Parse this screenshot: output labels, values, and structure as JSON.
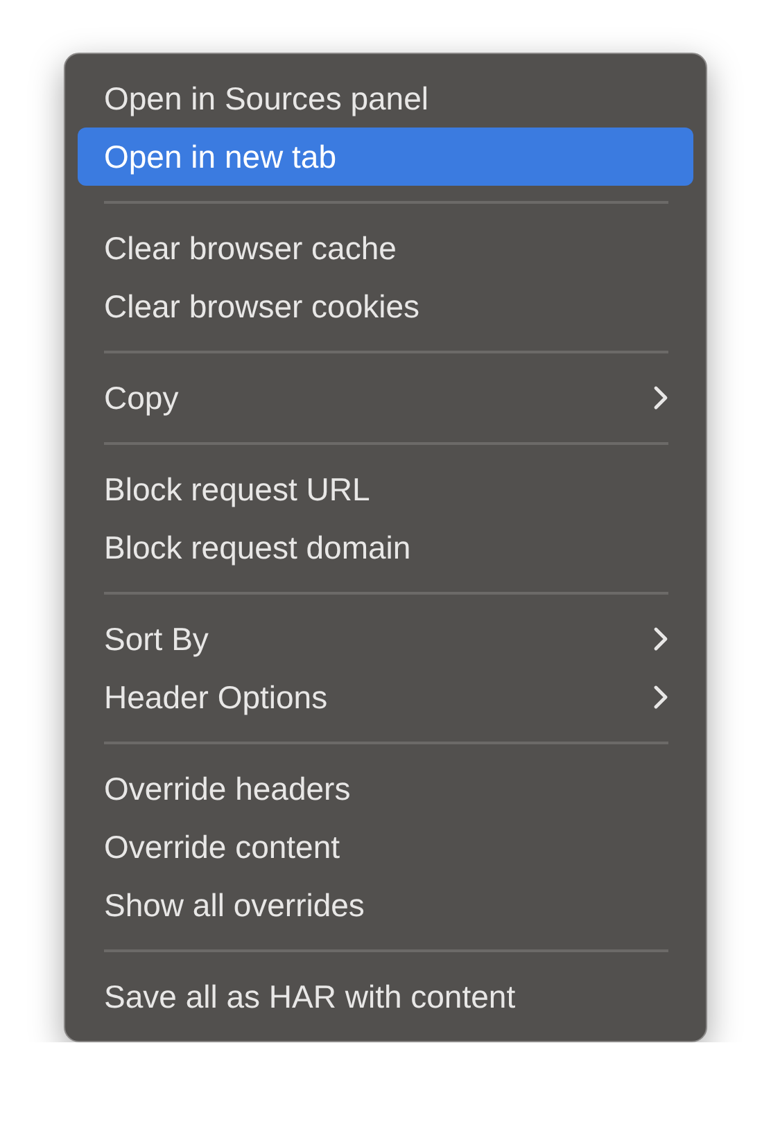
{
  "menu": {
    "groups": [
      {
        "items": [
          {
            "label": "Open in Sources panel",
            "selected": false,
            "submenu": false
          },
          {
            "label": "Open in new tab",
            "selected": true,
            "submenu": false
          }
        ]
      },
      {
        "items": [
          {
            "label": "Clear browser cache",
            "selected": false,
            "submenu": false
          },
          {
            "label": "Clear browser cookies",
            "selected": false,
            "submenu": false
          }
        ]
      },
      {
        "items": [
          {
            "label": "Copy",
            "selected": false,
            "submenu": true
          }
        ]
      },
      {
        "items": [
          {
            "label": "Block request URL",
            "selected": false,
            "submenu": false
          },
          {
            "label": "Block request domain",
            "selected": false,
            "submenu": false
          }
        ]
      },
      {
        "items": [
          {
            "label": "Sort By",
            "selected": false,
            "submenu": true
          },
          {
            "label": "Header Options",
            "selected": false,
            "submenu": true
          }
        ]
      },
      {
        "items": [
          {
            "label": "Override headers",
            "selected": false,
            "submenu": false
          },
          {
            "label": "Override content",
            "selected": false,
            "submenu": false
          },
          {
            "label": "Show all overrides",
            "selected": false,
            "submenu": false
          }
        ]
      },
      {
        "items": [
          {
            "label": "Save all as HAR with content",
            "selected": false,
            "submenu": false
          }
        ]
      }
    ]
  }
}
